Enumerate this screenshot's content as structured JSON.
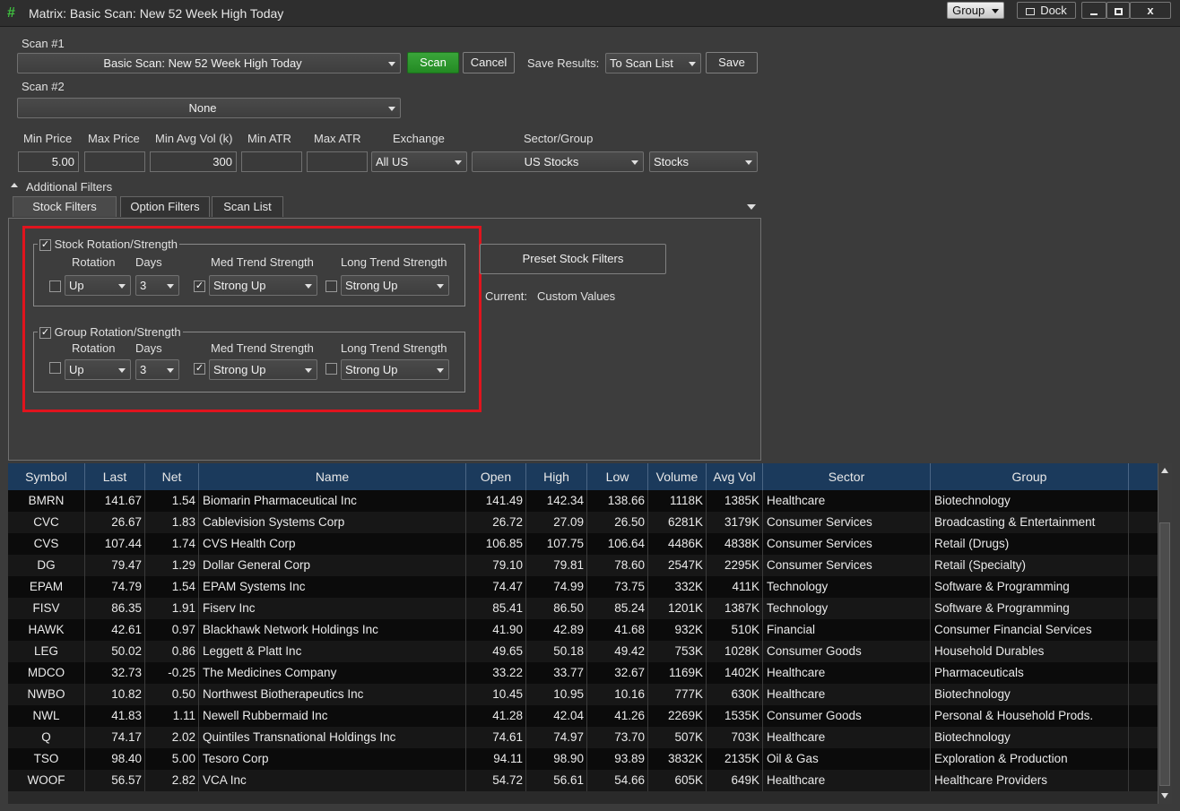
{
  "window": {
    "title": "Matrix: Basic Scan: New 52 Week High Today",
    "group_label": "Group",
    "dock_label": "Dock",
    "close_label": "x"
  },
  "scan1": {
    "label": "Scan #1",
    "value": "Basic Scan: New 52 Week High Today"
  },
  "scan2": {
    "label": "Scan #2",
    "value": "None"
  },
  "buttons": {
    "scan": "Scan",
    "cancel": "Cancel",
    "save": "Save"
  },
  "save_results": {
    "label": "Save Results:",
    "value": "To Scan List"
  },
  "filters": {
    "min_price_label": "Min Price",
    "min_price": "5.00",
    "max_price_label": "Max Price",
    "max_price": "",
    "min_avg_vol_label": "Min Avg Vol (k)",
    "min_avg_vol": "300",
    "min_atr_label": "Min ATR",
    "min_atr": "",
    "max_atr_label": "Max ATR",
    "max_atr": "",
    "exchange_label": "Exchange",
    "exchange": "All US",
    "sector_label": "Sector/Group",
    "sector": "US Stocks",
    "group": "Stocks"
  },
  "additional_filters": "Additional Filters",
  "tabs": [
    "Stock Filters",
    "Option Filters",
    "Scan List"
  ],
  "stock_rotation": {
    "title": "Stock Rotation/Strength",
    "rotation_label": "Rotation",
    "rotation": "Up",
    "days_label": "Days",
    "days": "3",
    "med_label": "Med Trend Strength",
    "med": "Strong Up",
    "long_label": "Long Trend Strength",
    "long": "Strong Up"
  },
  "group_rotation": {
    "title": "Group Rotation/Strength",
    "rotation_label": "Rotation",
    "rotation": "Up",
    "days_label": "Days",
    "days": "3",
    "med_label": "Med Trend Strength",
    "med": "Strong Up",
    "long_label": "Long Trend Strength",
    "long": "Strong Up"
  },
  "preset": {
    "button": "Preset Stock Filters",
    "current_label": "Current:",
    "current_value": "Custom Values"
  },
  "table": {
    "columns": [
      "Symbol",
      "Last",
      "Net",
      "Name",
      "Open",
      "High",
      "Low",
      "Volume",
      "Avg Vol",
      "Sector",
      "Group"
    ],
    "rows": [
      [
        "BMRN",
        "141.67",
        "1.54",
        "Biomarin Pharmaceutical Inc",
        "141.49",
        "142.34",
        "138.66",
        "1118K",
        "1385K",
        "Healthcare",
        "Biotechnology"
      ],
      [
        "CVC",
        "26.67",
        "1.83",
        "Cablevision Systems Corp",
        "26.72",
        "27.09",
        "26.50",
        "6281K",
        "3179K",
        "Consumer Services",
        "Broadcasting & Entertainment"
      ],
      [
        "CVS",
        "107.44",
        "1.74",
        "CVS Health Corp",
        "106.85",
        "107.75",
        "106.64",
        "4486K",
        "4838K",
        "Consumer Services",
        "Retail (Drugs)"
      ],
      [
        "DG",
        "79.47",
        "1.29",
        "Dollar General Corp",
        "79.10",
        "79.81",
        "78.60",
        "2547K",
        "2295K",
        "Consumer Services",
        "Retail (Specialty)"
      ],
      [
        "EPAM",
        "74.79",
        "1.54",
        "EPAM Systems Inc",
        "74.47",
        "74.99",
        "73.75",
        "332K",
        "411K",
        "Technology",
        "Software & Programming"
      ],
      [
        "FISV",
        "86.35",
        "1.91",
        "Fiserv Inc",
        "85.41",
        "86.50",
        "85.24",
        "1201K",
        "1387K",
        "Technology",
        "Software & Programming"
      ],
      [
        "HAWK",
        "42.61",
        "0.97",
        "Blackhawk Network Holdings Inc",
        "41.90",
        "42.89",
        "41.68",
        "932K",
        "510K",
        "Financial",
        "Consumer Financial Services"
      ],
      [
        "LEG",
        "50.02",
        "0.86",
        "Leggett & Platt Inc",
        "49.65",
        "50.18",
        "49.42",
        "753K",
        "1028K",
        "Consumer Goods",
        "Household Durables"
      ],
      [
        "MDCO",
        "32.73",
        "-0.25",
        "The Medicines Company",
        "33.22",
        "33.77",
        "32.67",
        "1169K",
        "1402K",
        "Healthcare",
        "Pharmaceuticals"
      ],
      [
        "NWBO",
        "10.82",
        "0.50",
        "Northwest Biotherapeutics Inc",
        "10.45",
        "10.95",
        "10.16",
        "777K",
        "630K",
        "Healthcare",
        "Biotechnology"
      ],
      [
        "NWL",
        "41.83",
        "1.11",
        "Newell Rubbermaid Inc",
        "41.28",
        "42.04",
        "41.26",
        "2269K",
        "1535K",
        "Consumer Goods",
        "Personal & Household Prods."
      ],
      [
        "Q",
        "74.17",
        "2.02",
        "Quintiles Transnational Holdings Inc",
        "74.61",
        "74.97",
        "73.70",
        "507K",
        "703K",
        "Healthcare",
        "Biotechnology"
      ],
      [
        "TSO",
        "98.40",
        "5.00",
        "Tesoro Corp",
        "94.11",
        "98.90",
        "93.89",
        "3832K",
        "2135K",
        "Oil & Gas",
        "Exploration & Production"
      ],
      [
        "WOOF",
        "56.57",
        "2.82",
        "VCA Inc",
        "54.72",
        "56.61",
        "54.66",
        "605K",
        "649K",
        "Healthcare",
        "Healthcare Providers"
      ]
    ]
  },
  "colors": {
    "accent_green": "#2a962a",
    "highlight_red": "#e0141e",
    "grid_header": "#1b3a5c"
  }
}
